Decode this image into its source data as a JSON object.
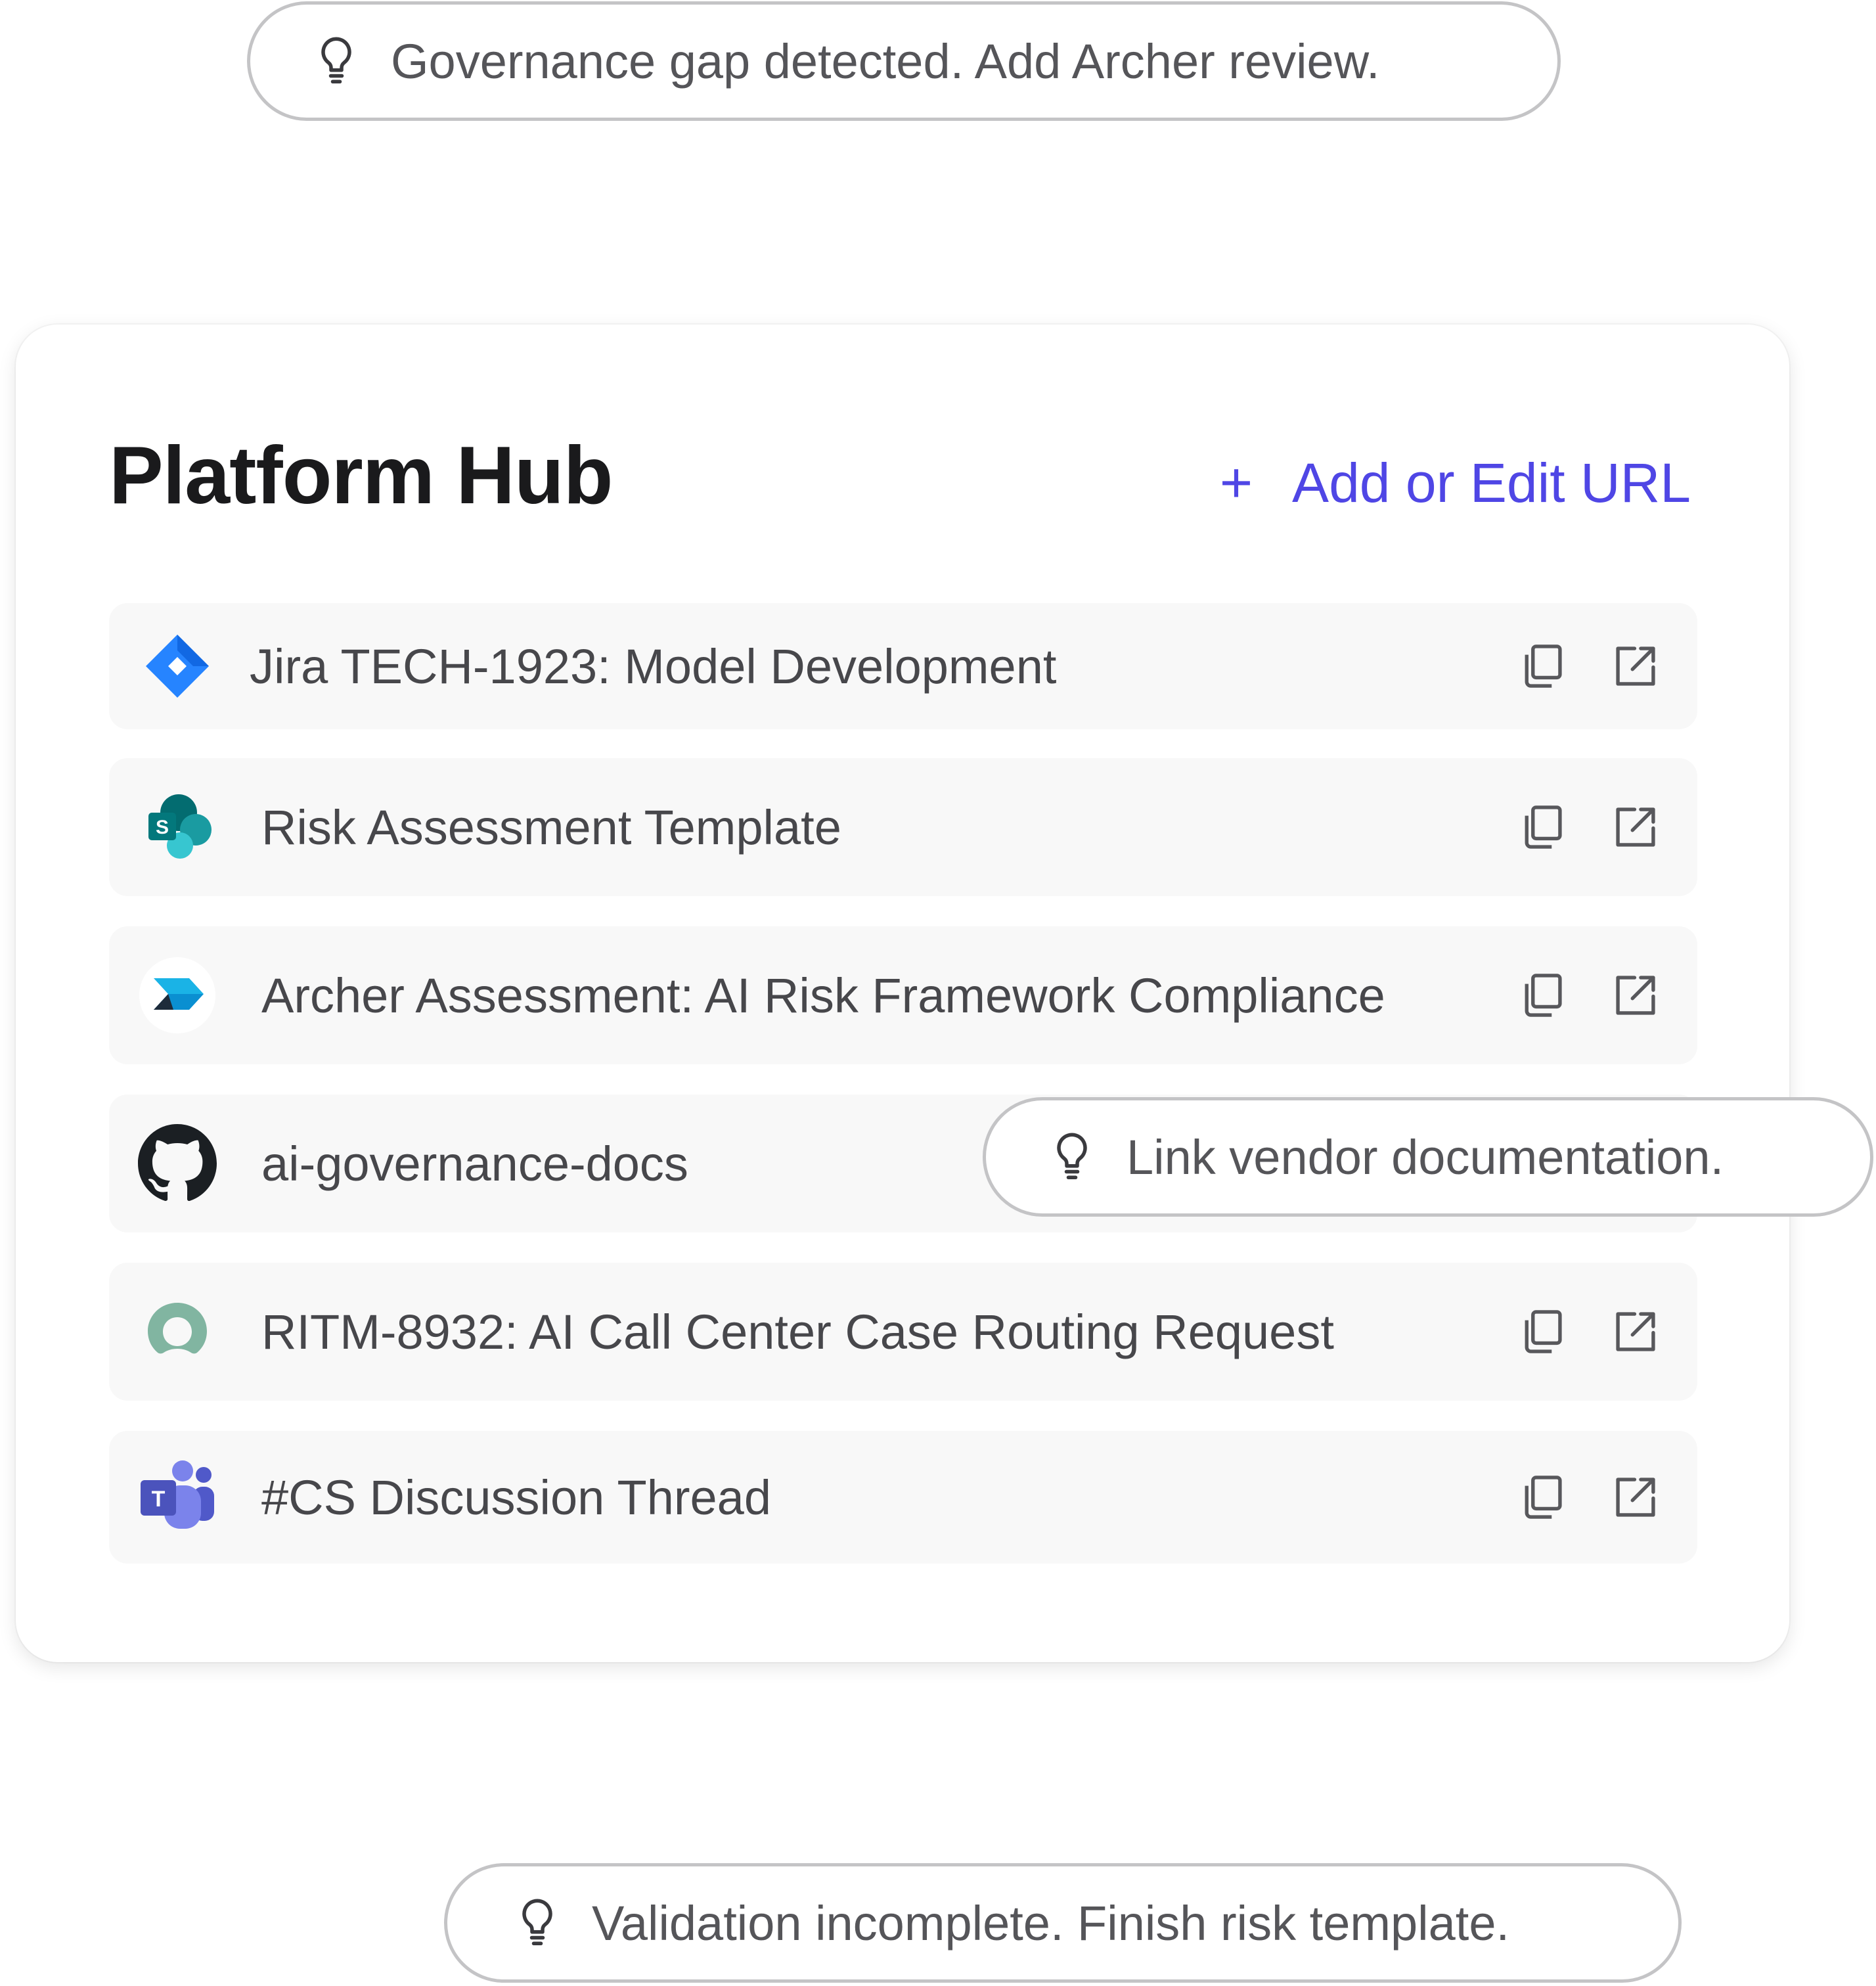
{
  "suggestions": {
    "top": "Governance gap detected. Add Archer review.",
    "middle": "Link vendor documentation.",
    "bottom": "Validation incomplete. Finish risk template."
  },
  "hub": {
    "title": "Platform Hub",
    "add_label": "Add or Edit URL",
    "add_icon": "+",
    "accent_color": "#4f46e5",
    "items": [
      {
        "label": "Jira TECH-1923: Model Development",
        "icon": "jira-icon"
      },
      {
        "label": "Risk Assessment Template",
        "icon": "sharepoint-icon"
      },
      {
        "label": "Archer Assessment: AI Risk Framework Compliance",
        "icon": "archer-icon"
      },
      {
        "label": "ai-governance-docs",
        "icon": "github-icon"
      },
      {
        "label": "RITM-8932: AI Call Center Case Routing Request",
        "icon": "servicenow-icon"
      },
      {
        "label": "#CS Discussion Thread",
        "icon": "teams-icon"
      }
    ]
  }
}
